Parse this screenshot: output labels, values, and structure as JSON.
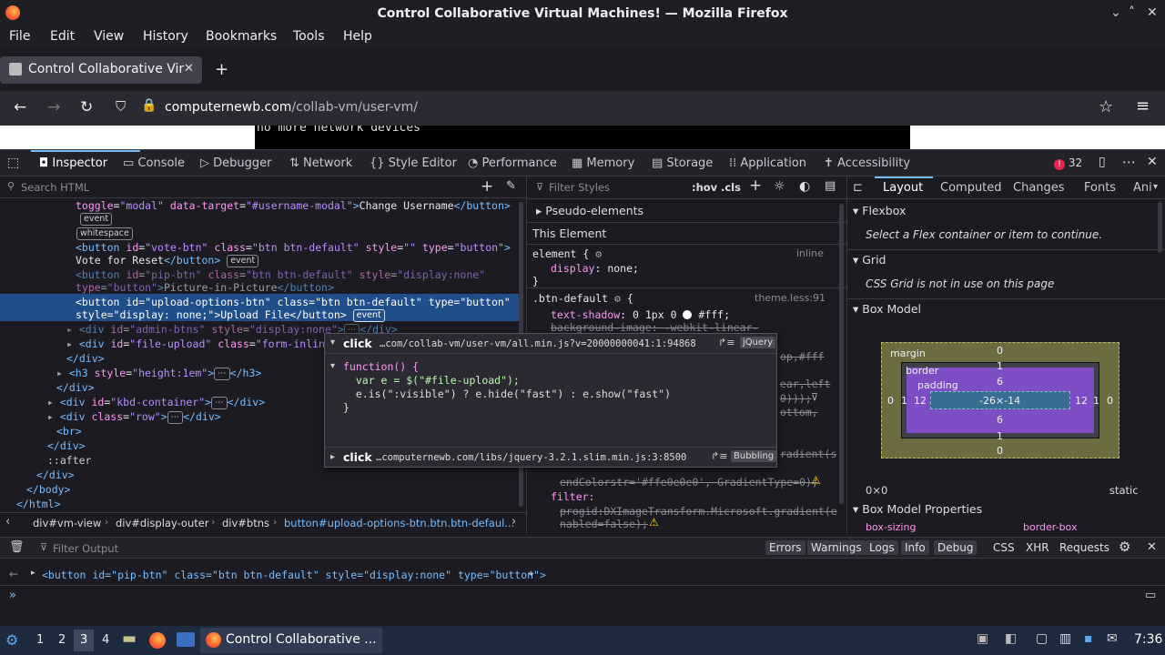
{
  "window": {
    "title": "Control Collaborative Virtual Machines! — Mozilla Firefox"
  },
  "menu": [
    "File",
    "Edit",
    "View",
    "History",
    "Bookmarks",
    "Tools",
    "Help"
  ],
  "tab": {
    "title": "Control Collaborative Virtual Machines!",
    "title_visible": "Control Collaborative Vir"
  },
  "url": {
    "domain": "computernewb.com",
    "path": "/collab-vm/user-vm/"
  },
  "page": {
    "visible_text": "no more network devices"
  },
  "devtools": {
    "tabs": [
      "Inspector",
      "Console",
      "Debugger",
      "Network",
      "Style Editor",
      "Performance",
      "Memory",
      "Storage",
      "Application",
      "Accessibility"
    ],
    "error_count": "32",
    "search_html_placeholder": "Search HTML",
    "filter_styles_placeholder": "Filter Styles",
    "hov": ":hov",
    "cls": ".cls",
    "html_lines": [
      {
        "id": "l1",
        "text": "toggle=\"modal\" data-target=\"#username-modal\">Change Username</button>"
      },
      {
        "id": "l2",
        "text": "<button id=\"vote-btn\" class=\"btn btn-default\" style=\"\" type=\"button\">"
      },
      {
        "id": "l3",
        "text": "Vote for Reset</button>"
      },
      {
        "id": "l4",
        "text": "<button id=\"pip-btn\" class=\"btn btn-default\" style=\"display:none\""
      },
      {
        "id": "l5",
        "text": "type=\"button\">Picture-in-Picture</button>"
      },
      {
        "id": "l6",
        "text": "<button id=\"upload-options-btn\" class=\"btn btn-default\" type=\"button\""
      },
      {
        "id": "l7",
        "text": "style=\"display: none;\">Upload File</button>"
      },
      {
        "id": "l8",
        "text": "<div id=\"admin-btns\" style=\"display:none\"></div>"
      },
      {
        "id": "l9",
        "text": "<div id=\"file-upload\" class=\"form-inline\""
      },
      {
        "id": "l10",
        "text": "</div>"
      },
      {
        "id": "l11",
        "text": "<h3 style=\"height:1em\"></h3>"
      },
      {
        "id": "l12",
        "text": "</div>"
      },
      {
        "id": "l13",
        "text": "<div id=\"kbd-container\"></div>"
      },
      {
        "id": "l14",
        "text": "<div class=\"row\"></div>"
      },
      {
        "id": "l15",
        "text": "<br>"
      },
      {
        "id": "l16",
        "text": "</div>"
      },
      {
        "id": "l17",
        "text": "::after"
      },
      {
        "id": "l18",
        "text": "</div>"
      },
      {
        "id": "l19",
        "text": "</body>"
      },
      {
        "id": "l20",
        "text": "</html>"
      }
    ],
    "badges": {
      "event": "event",
      "whitespace": "whitespace"
    },
    "popup": {
      "click1": "click",
      "src1": "…com/collab-vm/user-vm/all.min.js?v=20000000041:1:94868",
      "lib1": "jQuery",
      "code": [
        "function() {",
        "  var e = $(\"#file-upload\");",
        "  e.is(\":visible\") ? e.hide(\"fast\") : e.show(\"fast\")",
        "}"
      ],
      "click2": "click",
      "src2": "…computernewb.com/libs/jquery-3.2.1.slim.min.js:3:8500",
      "lib2": "Bubbling"
    },
    "rules": {
      "pseudo": "Pseudo-elements",
      "this_element": "This Element",
      "element_sel": "element {",
      "element_src": "inline",
      "display_prop": "display",
      "display_val": "none;",
      "btn_sel": ".btn-default",
      "btn_src": "theme.less:91",
      "shadow_prop": "text-shadow",
      "shadow_val": "0 1px 0",
      "shadow_color": "#fff;",
      "bg_prop": "background-image: -webkit-linear-",
      "frag1": "op,#fff",
      "frag2": "ear,left",
      "frag3": "0)));",
      "frag4": "ottom,",
      "frag5": "radient(s",
      "end_colorstr": "endColorstr='#ffe0e0e0', GradientType=0);",
      "filter_prop": "filter:",
      "filter_val1": "progid:DXImageTransform.Microsoft.gradient(e",
      "filter_val2": "nabled=false);"
    },
    "layout_tabs": [
      "Layout",
      "Computed",
      "Changes",
      "Fonts",
      "Ani"
    ],
    "flexbox": {
      "title": "Flexbox",
      "msg": "Select a Flex container or item to continue."
    },
    "grid": {
      "title": "Grid",
      "msg": "CSS Grid is not in use on this page"
    },
    "box_model": {
      "title": "Box Model",
      "margin_label": "margin",
      "border_label": "border",
      "padding_label": "padding",
      "margin_top": "0",
      "margin_bottom": "0",
      "margin_left": "0",
      "margin_right": "0",
      "border_top": "1",
      "border_bottom": "1",
      "border_left": "1",
      "border_right": "1",
      "padding_top": "6",
      "padding_bottom": "6",
      "padding_left": "12",
      "padding_right": "12",
      "content": "-26×-14",
      "size": "0×0",
      "position": "static"
    },
    "box_props": {
      "title": "Box Model Properties",
      "prop": "box-sizing",
      "val": "border-box"
    },
    "breadcrumb": [
      "div#vm-view",
      "div#display-outer",
      "div#btns",
      "button#upload-options-btn.btn.btn-defaul..."
    ],
    "console": {
      "filter_placeholder": "Filter Output",
      "levels": [
        "Errors",
        "Warnings",
        "Logs",
        "Info",
        "Debug"
      ],
      "extras": [
        "CSS",
        "XHR",
        "Requests"
      ],
      "output": "<button id=\"pip-btn\" class=\"btn btn-default\" style=\"display:none\" type=\"button\">"
    }
  },
  "taskbar": {
    "workspaces": [
      "1",
      "2",
      "3",
      "4"
    ],
    "app_title": "Control Collaborative ...",
    "time": "7:36"
  }
}
